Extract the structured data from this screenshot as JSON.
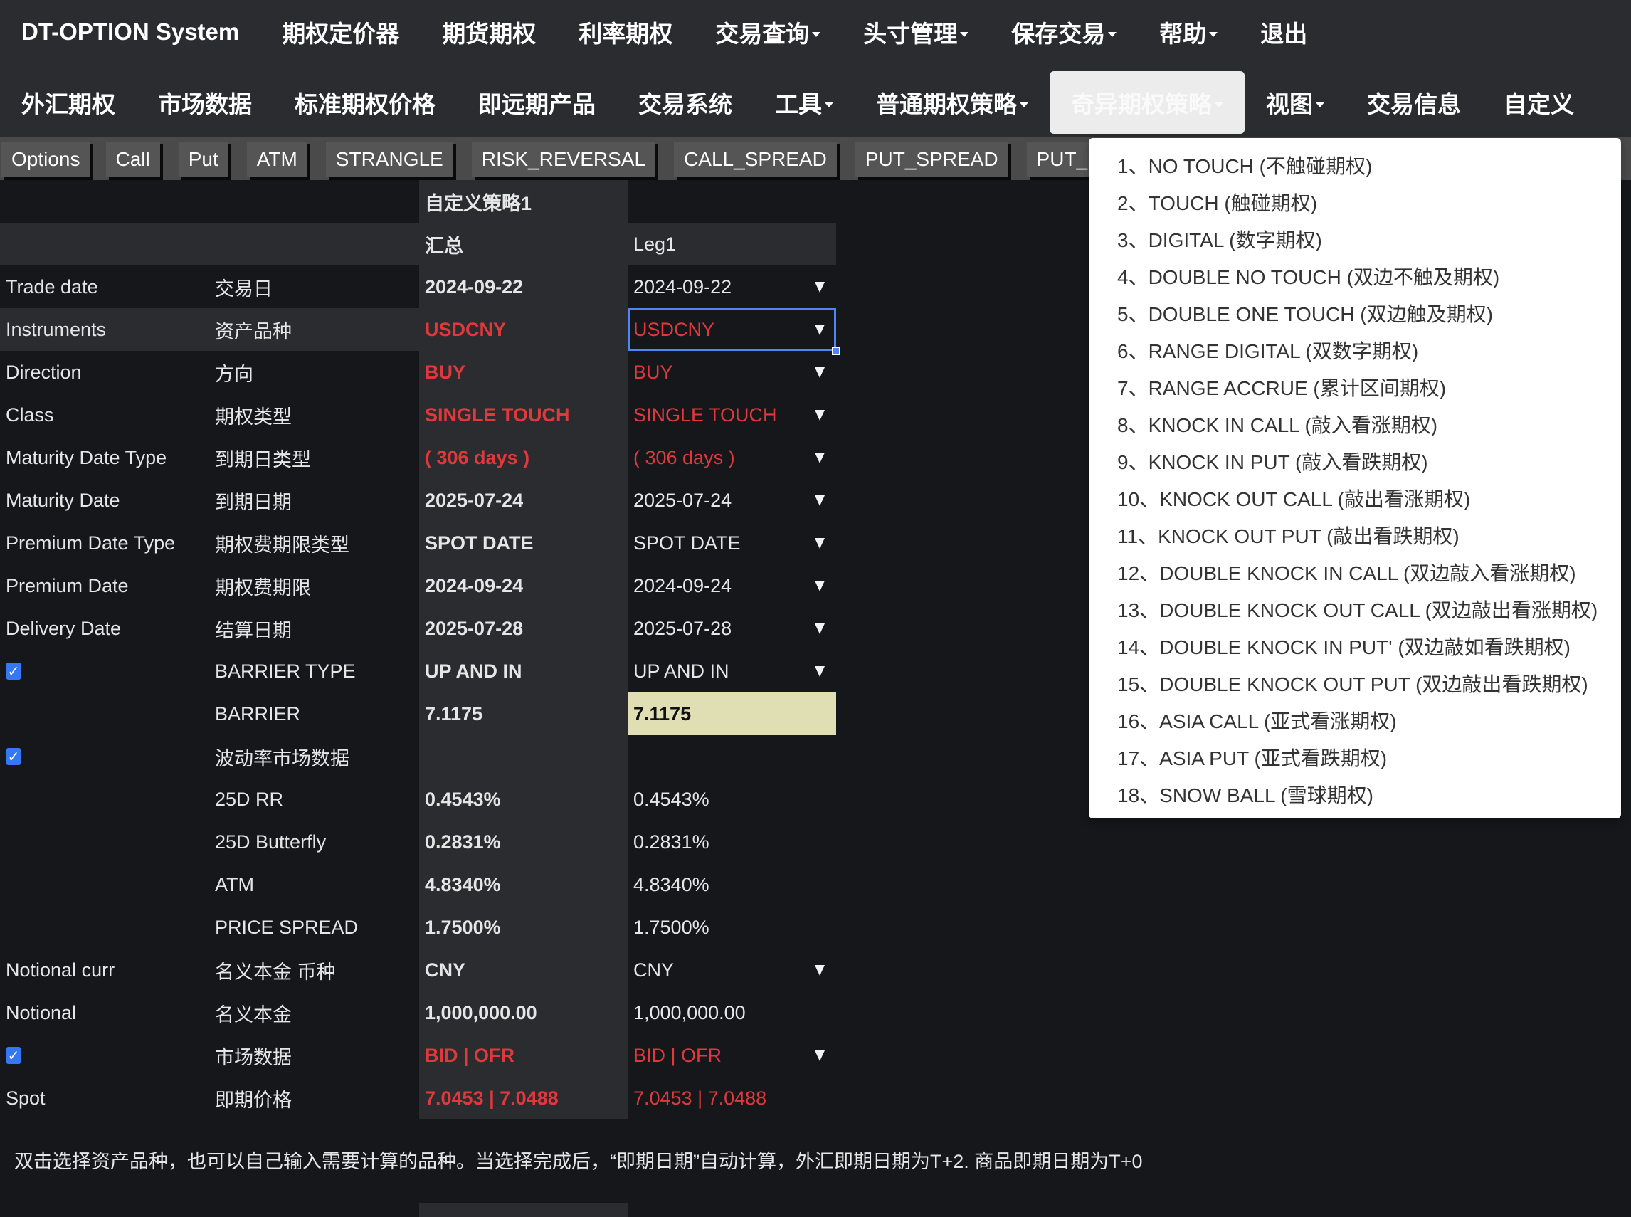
{
  "navbar": {
    "brand": "DT-OPTION System",
    "row1": [
      {
        "label": "期权定价器",
        "caret": false
      },
      {
        "label": "期货期权",
        "caret": false
      },
      {
        "label": "利率期权",
        "caret": false
      },
      {
        "label": "交易查询",
        "caret": true
      },
      {
        "label": "头寸管理",
        "caret": true
      },
      {
        "label": "保存交易",
        "caret": true
      },
      {
        "label": "帮助",
        "caret": true
      },
      {
        "label": "退出",
        "caret": false
      }
    ],
    "row2": [
      {
        "label": "外汇期权",
        "caret": false
      },
      {
        "label": "市场数据",
        "caret": false
      },
      {
        "label": "标准期权价格",
        "caret": false
      },
      {
        "label": "即远期产品",
        "caret": false
      },
      {
        "label": "交易系统",
        "caret": false
      },
      {
        "label": "工具",
        "caret": true
      },
      {
        "label": "普通期权策略",
        "caret": true
      },
      {
        "label": "奇异期权策略",
        "caret": true,
        "active": true
      },
      {
        "label": "视图",
        "caret": true
      },
      {
        "label": "交易信息",
        "caret": false
      },
      {
        "label": "自定义",
        "caret": false
      }
    ]
  },
  "toolbar": {
    "buttons": [
      "Options",
      "Call",
      "Put",
      "ATM",
      "STRANGLE",
      "RISK_REVERSAL",
      "CALL_SPREAD",
      "PUT_SPREAD",
      "PUT_"
    ]
  },
  "grid": {
    "strategy_title": "自定义策略1",
    "summary_header": "汇总",
    "leg_header": "Leg1",
    "rows": [
      {
        "en": "Trade date",
        "cn": "交易日",
        "summary": "2024-09-22",
        "leg": "2024-09-22",
        "dropdown": true,
        "red": false
      },
      {
        "en": "Instruments",
        "cn": "资产品种",
        "summary": "USDCNY",
        "leg": "USDCNY",
        "dropdown": true,
        "red": true,
        "focused": true
      },
      {
        "en": "Direction",
        "cn": "方向",
        "summary": "BUY",
        "leg": "BUY",
        "dropdown": true,
        "red": true
      },
      {
        "en": "Class",
        "cn": "期权类型",
        "summary": "SINGLE TOUCH",
        "leg": "SINGLE TOUCH",
        "dropdown": true,
        "red": true
      },
      {
        "en": "Maturity Date Type",
        "cn": "到期日类型",
        "summary": "( 306 days )",
        "leg": "( 306 days )",
        "dropdown": true,
        "red": true
      },
      {
        "en": "Maturity Date",
        "cn": "到期日期",
        "summary": "2025-07-24",
        "leg": "2025-07-24",
        "dropdown": true,
        "red": false
      },
      {
        "en": "Premium Date Type",
        "cn": "期权费期限类型",
        "summary": "SPOT DATE",
        "leg": "SPOT DATE",
        "dropdown": true,
        "red": false
      },
      {
        "en": "Premium Date",
        "cn": "期权费期限",
        "summary": "2024-09-24",
        "leg": "2024-09-24",
        "dropdown": true,
        "red": false
      },
      {
        "en": "Delivery Date",
        "cn": "结算日期",
        "summary": "2025-07-28",
        "leg": "2025-07-28",
        "dropdown": true,
        "red": false
      },
      {
        "en": "",
        "checkbox": true,
        "cn": "BARRIER TYPE",
        "summary": "UP AND IN",
        "leg": "UP AND IN",
        "dropdown": true,
        "red": false
      },
      {
        "en": "",
        "cn": "BARRIER",
        "summary": "7.1175",
        "leg": "7.1175",
        "dropdown": false,
        "red": false,
        "highlight": true
      },
      {
        "en": "",
        "checkbox": true,
        "cn": "波动率市场数据",
        "summary": "",
        "leg": "",
        "dropdown": false,
        "red": false
      },
      {
        "en": "",
        "cn": "25D RR",
        "summary": "0.4543%",
        "leg": "0.4543%",
        "dropdown": false,
        "red": false
      },
      {
        "en": "",
        "cn": "25D Butterfly",
        "summary": "0.2831%",
        "leg": "0.2831%",
        "dropdown": false,
        "red": false
      },
      {
        "en": "",
        "cn": "ATM",
        "summary": "4.8340%",
        "leg": "4.8340%",
        "dropdown": false,
        "red": false
      },
      {
        "en": "",
        "cn": "PRICE SPREAD",
        "summary": "1.7500%",
        "leg": "1.7500%",
        "dropdown": false,
        "red": false
      },
      {
        "en": "Notional curr",
        "cn": "名义本金 币种",
        "summary": "CNY",
        "leg": "CNY",
        "dropdown": true,
        "red": false
      },
      {
        "en": "Notional",
        "cn": "名义本金",
        "summary": "1,000,000.00",
        "leg": "1,000,000.00",
        "dropdown": false,
        "red": false
      },
      {
        "en": "",
        "checkbox": true,
        "cn": "市场数据",
        "summary": "BID | OFR",
        "leg": "BID | OFR",
        "dropdown": true,
        "red": true
      },
      {
        "en": "Spot",
        "cn": "即期价格",
        "summary": "7.0453 | 7.0488",
        "leg": "7.0453 | 7.0488",
        "dropdown": false,
        "red": true
      }
    ]
  },
  "note": "双击选择资产品种，也可以自己输入需要计算的品种。当选择完成后，“即期日期”自动计算，外汇即期日期为T+2. 商品即期日期为T+0",
  "dropdown": {
    "items": [
      "1、NO TOUCH (不触碰期权)",
      "2、TOUCH (触碰期权)",
      "3、DIGITAL (数字期权)",
      "4、DOUBLE NO TOUCH (双边不触及期权)",
      "5、DOUBLE ONE TOUCH (双边触及期权)",
      "6、RANGE DIGITAL (双数字期权)",
      "7、RANGE ACCRUE (累计区间期权)",
      "8、KNOCK IN CALL (敲入看涨期权)",
      "9、KNOCK IN PUT (敲入看跌期权)",
      "10、KNOCK OUT CALL (敲出看涨期权)",
      "11、KNOCK OUT PUT (敲出看跌期权)",
      "12、DOUBLE KNOCK IN CALL (双边敲入看涨期权)",
      "13、DOUBLE KNOCK OUT CALL (双边敲出看涨期权)",
      "14、DOUBLE KNOCK IN PUT' (双边敲如看跌期权)",
      "15、DOUBLE KNOCK OUT PUT (双边敲出看跌期权)",
      "16、ASIA CALL (亚式看涨期权)",
      "17、ASIA PUT (亚式看跌期权)",
      "18、SNOW BALL (雪球期权)"
    ]
  },
  "colors": {
    "accent_red": "#e0393c",
    "focus_blue": "#4f86f7",
    "checkbox_blue": "#3478f6",
    "barrier_highlight": "#dfdfb3"
  }
}
